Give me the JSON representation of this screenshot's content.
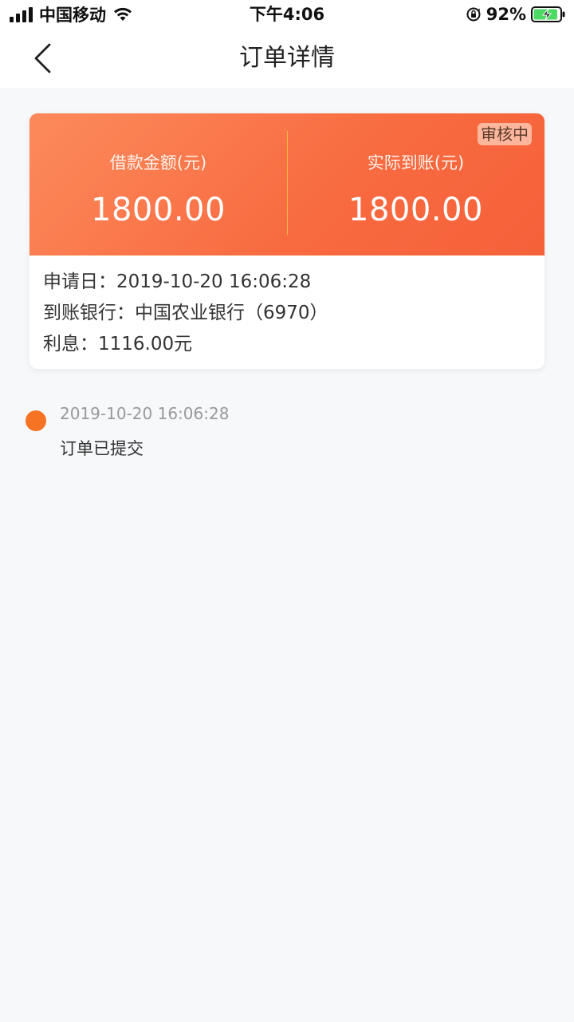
{
  "status_bar": {
    "carrier": "中国移动",
    "time": "下午4:06",
    "battery_percent": "92%",
    "battery_level": 0.92,
    "icons": [
      "signal-icon",
      "wifi-icon",
      "rotation-lock-icon",
      "battery-charging-icon"
    ]
  },
  "nav": {
    "title": "订单详情",
    "back_icon": "chevron-left-icon"
  },
  "summary": {
    "status_badge": "审核中",
    "loan_amount_label": "借款金额(元)",
    "loan_amount_value": "1800.00",
    "received_amount_label": "实际到账(元)",
    "received_amount_value": "1800.00",
    "info": {
      "apply_date": "申请日：2019-10-20 16:06:28",
      "bank": "到账银行：中国农业银行（6970）",
      "interest": "利息：1116.00元"
    }
  },
  "timeline": [
    {
      "time": "2019-10-20 16:06:28",
      "text": "订单已提交"
    }
  ],
  "colors": {
    "accent": "#f86a40",
    "timeline_dot": "#f57322",
    "divider": "#f5b840"
  }
}
